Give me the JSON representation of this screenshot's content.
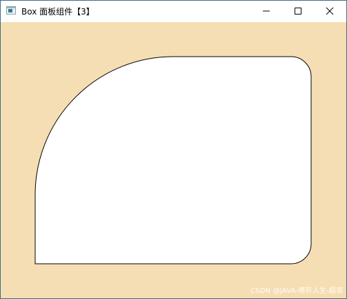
{
  "window": {
    "title": "Box 面板组件【3】"
  },
  "controls": {
    "minimize_icon": "minimize-icon",
    "maximize_icon": "maximize-icon",
    "close_icon": "close-icon"
  },
  "colors": {
    "client_background": "#f5deb3",
    "shape_fill": "#ffffff",
    "shape_stroke": "#000000",
    "window_border": "#3b6f80"
  },
  "watermark": "CSDN @JAVA-博弈人生-超哥"
}
